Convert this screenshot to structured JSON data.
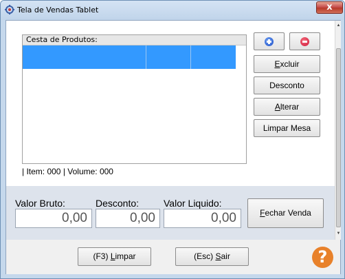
{
  "window": {
    "title": "Tela de Vendas Tablet",
    "close_glyph": "x"
  },
  "basket": {
    "caption": "Cesta de Produtos:",
    "status": "| Item: 000 | Volume: 000"
  },
  "actions": {
    "excluir": {
      "pre": "",
      "ul": "E",
      "post": "xcluir"
    },
    "desconto": "Desconto",
    "alterar": {
      "pre": "",
      "ul": "A",
      "post": "lterar"
    },
    "limpar_mesa": "Limpar Mesa"
  },
  "totals": {
    "valor_bruto_label": "Valor Bruto:",
    "valor_bruto": "0,00",
    "desconto_label": "Desconto:",
    "desconto": "0,00",
    "valor_liquido_label": "Valor Liquido:",
    "valor_liquido": "0,00",
    "fechar": {
      "pre": "",
      "ul": "F",
      "post": "echar Venda"
    }
  },
  "footer": {
    "limpar": {
      "pre": "(F3) ",
      "ul": "L",
      "post": "impar"
    },
    "sair": {
      "pre": "(Esc) ",
      "ul": "S",
      "post": "air"
    },
    "help_glyph": "?"
  },
  "icons": {
    "add": "plus-circle-icon",
    "remove": "minus-circle-icon",
    "help": "question-circle-icon",
    "app": "app-icon"
  },
  "colors": {
    "selection": "#3399ff",
    "add": "#1e4fc8",
    "remove": "#d0183a",
    "help": "#e8812a"
  }
}
